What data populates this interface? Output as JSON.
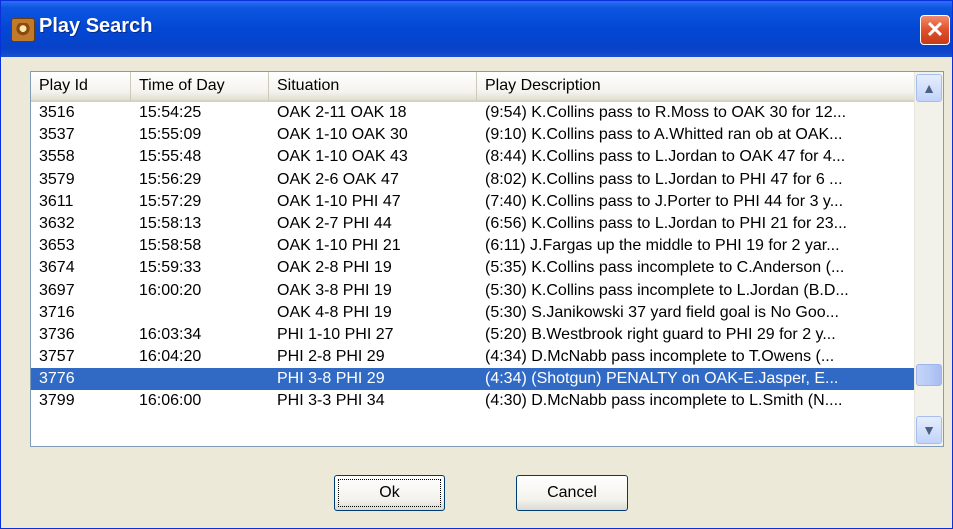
{
  "window": {
    "title": "Play Search",
    "close_glyph": "✕"
  },
  "columns": [
    "Play Id",
    "Time of Day",
    "Situation",
    "Play Description"
  ],
  "rows": [
    {
      "id": "3516",
      "time": "15:54:25",
      "situation": "OAK  2-11  OAK 18",
      "description": "(9:54) K.Collins pass to R.Moss to OAK 30 for 12..."
    },
    {
      "id": "3537",
      "time": "15:55:09",
      "situation": "OAK  1-10  OAK 30",
      "description": "(9:10) K.Collins pass to A.Whitted ran ob at OAK..."
    },
    {
      "id": "3558",
      "time": "15:55:48",
      "situation": "OAK  1-10  OAK 43",
      "description": "(8:44) K.Collins pass to L.Jordan to OAK 47 for 4..."
    },
    {
      "id": "3579",
      "time": "15:56:29",
      "situation": "OAK  2-6  OAK 47",
      "description": "(8:02) K.Collins pass to L.Jordan to PHI 47 for 6 ..."
    },
    {
      "id": "3611",
      "time": "15:57:29",
      "situation": "OAK  1-10  PHI 47",
      "description": "(7:40) K.Collins pass to J.Porter to PHI 44 for 3 y..."
    },
    {
      "id": "3632",
      "time": "15:58:13",
      "situation": "OAK  2-7  PHI 44",
      "description": "(6:56) K.Collins pass to L.Jordan to PHI 21 for 23..."
    },
    {
      "id": "3653",
      "time": "15:58:58",
      "situation": "OAK  1-10  PHI 21",
      "description": "(6:11) J.Fargas up the middle to PHI 19 for 2 yar..."
    },
    {
      "id": "3674",
      "time": "15:59:33",
      "situation": "OAK  2-8  PHI 19",
      "description": "(5:35) K.Collins pass incomplete to C.Anderson (..."
    },
    {
      "id": "3697",
      "time": "16:00:20",
      "situation": "OAK  3-8  PHI 19",
      "description": "(5:30) K.Collins pass incomplete to L.Jordan (B.D..."
    },
    {
      "id": "3716",
      "time": "",
      "situation": "OAK  4-8  PHI 19",
      "description": "(5:30) S.Janikowski 37 yard field goal is No Goo..."
    },
    {
      "id": "3736",
      "time": "16:03:34",
      "situation": "PHI  1-10  PHI 27",
      "description": "(5:20) B.Westbrook right guard to PHI 29 for 2 y..."
    },
    {
      "id": "3757",
      "time": "16:04:20",
      "situation": "PHI  2-8  PHI 29",
      "description": "(4:34) D.McNabb pass incomplete to T.Owens (..."
    },
    {
      "id": "3776",
      "time": "",
      "situation": "PHI  3-8  PHI 29",
      "description": "(4:34) (Shotgun) PENALTY on OAK-E.Jasper, E...",
      "selected": true
    },
    {
      "id": "3799",
      "time": "16:06:00",
      "situation": "PHI  3-3  PHI 34",
      "description": "(4:30) D.McNabb pass incomplete to L.Smith (N...."
    }
  ],
  "scrollbar": {
    "up_glyph": "▲",
    "down_glyph": "▼"
  },
  "buttons": {
    "ok": "Ok",
    "cancel": "Cancel"
  }
}
